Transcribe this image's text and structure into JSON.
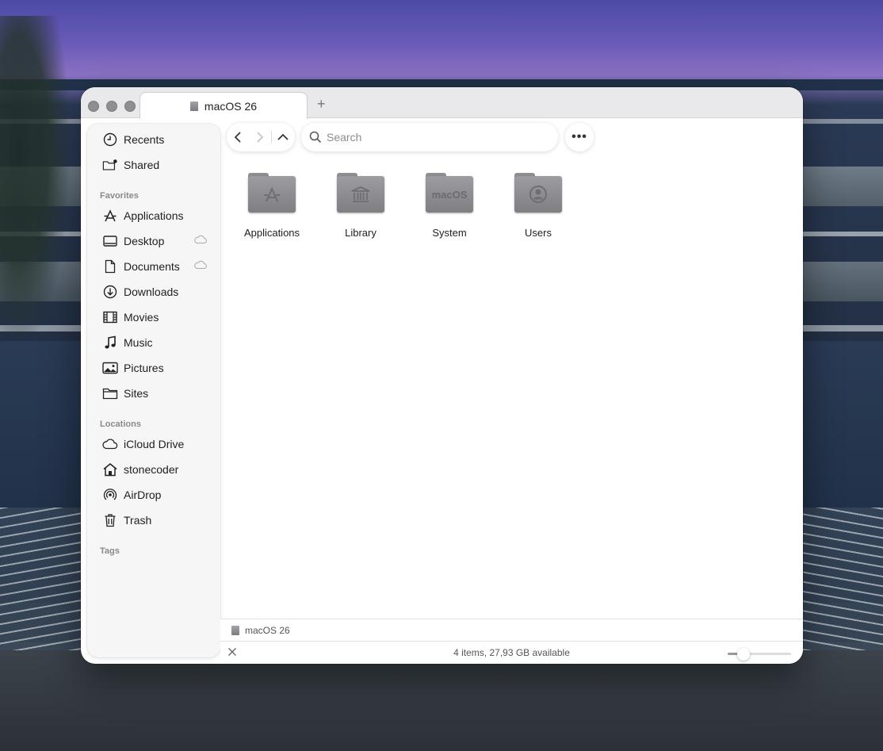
{
  "window": {
    "tab_title": "macOS 26",
    "new_tab_symbol": "+"
  },
  "sidebar": {
    "top_items": [
      {
        "label": "Recents",
        "icon": "clock-icon"
      },
      {
        "label": "Shared",
        "icon": "shared-folder-icon"
      }
    ],
    "favorites_header": "Favorites",
    "favorites": [
      {
        "label": "Applications",
        "icon": "applications-icon"
      },
      {
        "label": "Desktop",
        "icon": "desktop-icon",
        "cloud": true
      },
      {
        "label": "Documents",
        "icon": "document-icon",
        "cloud": true
      },
      {
        "label": "Downloads",
        "icon": "download-icon"
      },
      {
        "label": "Movies",
        "icon": "film-icon"
      },
      {
        "label": "Music",
        "icon": "music-note-icon"
      },
      {
        "label": "Pictures",
        "icon": "photo-icon"
      },
      {
        "label": "Sites",
        "icon": "folder-icon"
      }
    ],
    "locations_header": "Locations",
    "locations": [
      {
        "label": "iCloud Drive",
        "icon": "cloud-icon"
      },
      {
        "label": "stonecoder",
        "icon": "home-icon"
      },
      {
        "label": "AirDrop",
        "icon": "airdrop-icon"
      },
      {
        "label": "Trash",
        "icon": "trash-icon"
      }
    ],
    "tags_header": "Tags"
  },
  "toolbar": {
    "search_placeholder": "Search",
    "more_label": "•••"
  },
  "content": {
    "items": [
      {
        "name": "Applications",
        "emblem": "A"
      },
      {
        "name": "Library",
        "emblem": "🏛"
      },
      {
        "name": "System",
        "emblem": "macOS"
      },
      {
        "name": "Users",
        "emblem": "👤"
      }
    ]
  },
  "pathbar": {
    "label": "macOS 26"
  },
  "statusbar": {
    "text": "4 items, 27,93 GB available",
    "icon_size_level": 0.25
  }
}
